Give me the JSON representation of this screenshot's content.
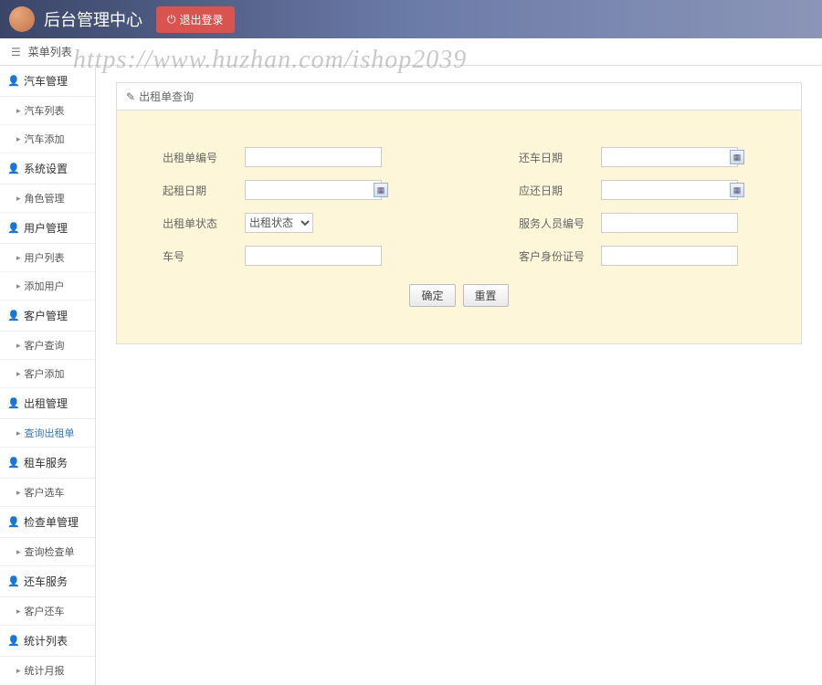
{
  "header": {
    "title": "后台管理中心",
    "logout_label": "退出登录"
  },
  "breadcrumb": {
    "label": "菜单列表"
  },
  "watermark": "https://www.huzhan.com/ishop2039",
  "sidebar": {
    "groups": [
      {
        "label": "汽车管理",
        "icon": "user",
        "items": [
          {
            "label": "汽车列表"
          },
          {
            "label": "汽车添加"
          }
        ]
      },
      {
        "label": "系统设置",
        "icon": "user",
        "items": [
          {
            "label": "角色管理"
          }
        ]
      },
      {
        "label": "用户管理",
        "icon": "user",
        "items": [
          {
            "label": "用户列表"
          },
          {
            "label": "添加用户"
          }
        ]
      },
      {
        "label": "客户管理",
        "icon": "user",
        "items": [
          {
            "label": "客户查询"
          },
          {
            "label": "客户添加"
          }
        ]
      },
      {
        "label": "出租管理",
        "icon": "user",
        "items": [
          {
            "label": "查询出租单",
            "active": true
          }
        ]
      },
      {
        "label": "租车服务",
        "icon": "user",
        "items": [
          {
            "label": "客户选车"
          }
        ]
      },
      {
        "label": "检查单管理",
        "icon": "user",
        "items": [
          {
            "label": "查询检查单"
          }
        ]
      },
      {
        "label": "还车服务",
        "icon": "user",
        "items": [
          {
            "label": "客户还车"
          }
        ]
      },
      {
        "label": "统计列表",
        "icon": "user",
        "items": [
          {
            "label": "统计月报"
          }
        ]
      }
    ]
  },
  "panel": {
    "title": "出租单查询"
  },
  "form": {
    "labels": {
      "rent_id": "出租单编号",
      "return_date": "还车日期",
      "begin_date": "起租日期",
      "should_return": "应还日期",
      "status": "出租单状态",
      "operator_id": "服务人员编号",
      "car_no": "车号",
      "customer_id": "客户身份证号"
    },
    "status_selected": "出租状态",
    "buttons": {
      "confirm": "确定",
      "reset": "重置"
    }
  }
}
